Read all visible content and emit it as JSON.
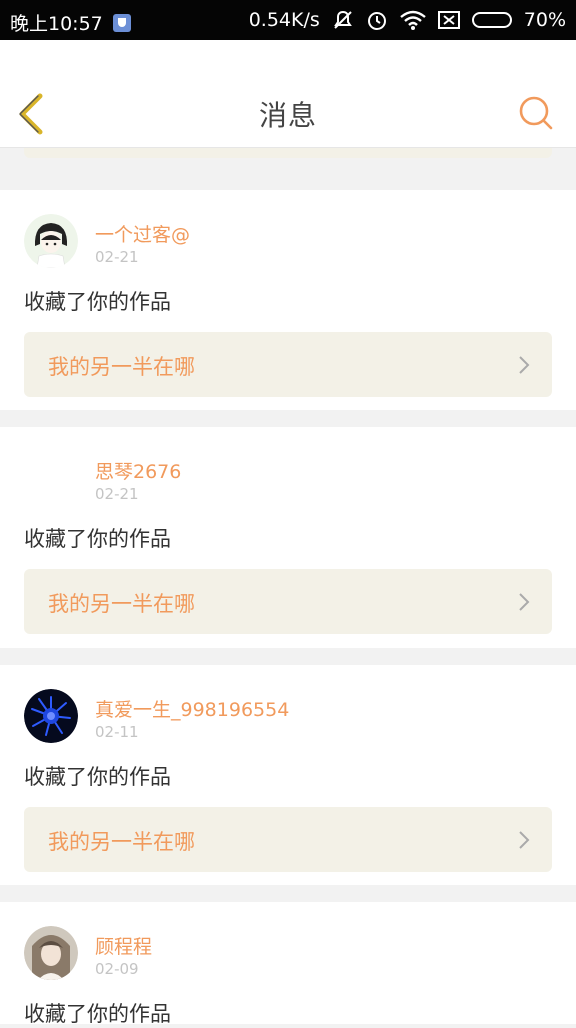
{
  "status_bar": {
    "time": "晚上10:57",
    "speed": "0.54K/s",
    "battery_percent": "70%",
    "battery_level": 0.7,
    "icons": [
      "app-shield-icon",
      "mute-icon",
      "alarm-icon",
      "wifi-icon",
      "no-sim-icon",
      "battery-icon"
    ]
  },
  "header": {
    "title": "消息",
    "back_icon": "back-chevron-icon",
    "search_icon": "search-icon"
  },
  "colors": {
    "accent": "#f19a5c",
    "card_bg": "#f3f1e7",
    "back_arrow": "#d9b52a"
  },
  "messages": [
    {
      "username": "一个过客@",
      "date": "02-21",
      "action": "收藏了你的作品",
      "work_title": "我的另一半在哪",
      "avatar": "cartoon-girl-avatar"
    },
    {
      "username": "思琴2676",
      "date": "02-21",
      "action": "收藏了你的作品",
      "work_title": "我的另一半在哪",
      "avatar": "blank-avatar"
    },
    {
      "username": "真爱一生_998196554",
      "date": "02-11",
      "action": "收藏了你的作品",
      "work_title": "我的另一半在哪",
      "avatar": "blue-flower-avatar"
    },
    {
      "username": "顾程程",
      "date": "02-09",
      "action": "收藏了你的作品",
      "work_title": "",
      "avatar": "photo-avatar"
    }
  ]
}
